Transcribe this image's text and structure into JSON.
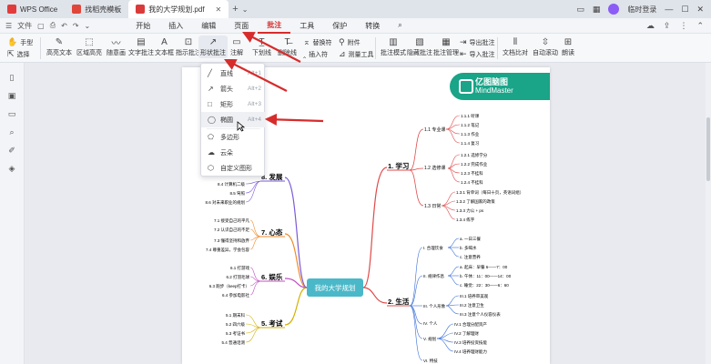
{
  "titlebar": {
    "tabs": [
      {
        "label": "WPS Office",
        "icon": "wps-logo-icon"
      },
      {
        "label": "找稻壳模板",
        "icon": "docer-icon"
      },
      {
        "label": "我的大学规划.pdf",
        "icon": "pdf-file-icon"
      }
    ],
    "login_label": "临时登录"
  },
  "menubar": {
    "file_label": "文件",
    "items": [
      "开始",
      "插入",
      "编辑",
      "页面",
      "批注",
      "工具",
      "保护",
      "转换"
    ]
  },
  "ribbon": {
    "hand_label": "手型",
    "select_label": "选择",
    "highlight_label": "高亮文本",
    "area_highlight_label": "区域高亮",
    "freehand_label": "随意画",
    "text_comment_label": "文字批注",
    "textbox_label": "文本框",
    "callout_label": "指示批注",
    "shape_comment_label": "形状批注",
    "note_label": "注解",
    "underline_label": "下划线",
    "delete_line_label": "删除线",
    "replace_char_label": "替换符",
    "insert_char_label": "插入符",
    "attachment_label": "附件",
    "measure_label": "测量工具",
    "comment_mode_label": "批注模式",
    "hide_comment_label": "隐藏批注",
    "comment_manage_label": "批注管理",
    "export_comment_label": "导出批注",
    "import_comment_label": "导入批注",
    "doc_compare_label": "文档比对",
    "auto_scroll_label": "自动滚动",
    "read_label": "朗读"
  },
  "dropdown": {
    "items": [
      {
        "label": "直线",
        "shortcut": "Alt+1",
        "icon": "line-icon"
      },
      {
        "label": "箭头",
        "shortcut": "Alt+2",
        "icon": "arrow-icon"
      },
      {
        "label": "矩形",
        "shortcut": "Alt+3",
        "icon": "rectangle-icon"
      },
      {
        "label": "椭圆",
        "shortcut": "Alt+4",
        "icon": "ellipse-icon"
      },
      {
        "label": "多边形",
        "shortcut": "",
        "icon": "polygon-icon"
      },
      {
        "label": "云朵",
        "shortcut": "",
        "icon": "cloud-icon"
      },
      {
        "label": "自定义图形",
        "shortcut": "",
        "icon": "custom-shape-icon"
      }
    ]
  },
  "mindmap": {
    "brand_line1": "亿图脑图",
    "brand_line2": "MindMaster",
    "root": "我的大学规划",
    "branches": {
      "study": {
        "label": "1. 学习",
        "sub": [
          "1.1 专业课",
          "1.2 选修课",
          "1.3 日常"
        ]
      },
      "life": {
        "label": "2. 生活",
        "sub": [
          "I. 合理饮食",
          "II. 规律作息",
          "III. 个人形象",
          "IV. 个人",
          "V. 规划",
          "VI. 特技"
        ]
      },
      "exam": {
        "label": "5. 考试",
        "sub": [
          "5.1 期末科",
          "5.2 四六级",
          "5.3 考证书",
          "5.4 普通话测"
        ]
      },
      "fun": {
        "label": "6. 娱乐",
        "sub": [
          "6.1 打游戏",
          "6.2 打羽毛球",
          "6.3 跑步（keep打卡）",
          "6.4 参加电影社"
        ]
      },
      "mind": {
        "label": "7. 心态",
        "sub": [
          "7.1 接受自己的平凡",
          "7.2 认识自己的不足",
          "7.3 懂得坚持和放弃",
          "7.4 尊重差异，学会包容"
        ]
      },
      "develop": {
        "label": "8. 发展",
        "sub": [
          "8.4 计算机二级",
          "8.5 驾照",
          "8.6 对未来职业的规划"
        ]
      }
    },
    "study_leaves": [
      "1.1.1 听课",
      "1.1.2 笔记",
      "1.1.3 作业",
      "1.1.4 复习",
      "1.2.1 选修学分",
      "1.2.2 完成作业",
      "1.2.3 不挂科",
      "1.2.4 不挂科",
      "1.3.1 背单词（每日十页，英语词组）",
      "1.3.2 了解国家的政策",
      "1.3.3 力公 + ps",
      "1.3.4 练字"
    ],
    "life_leaves": [
      "a. 一日三餐",
      "b. 多喝水",
      "c. 注意营养",
      "a. 起床：早餐 6——7：00",
      "b. 午休：11：00——14：00",
      "c. 睡觉：22：30——6：60",
      "III.1 培养审美观",
      "III.2 注意卫生",
      "III.3 注意个人仪容仪表",
      "IV.1 合理分配资产",
      "IV.2 了解理财",
      "IV.3 培养投资技能",
      "IV.4 培养理财能力"
    ]
  }
}
